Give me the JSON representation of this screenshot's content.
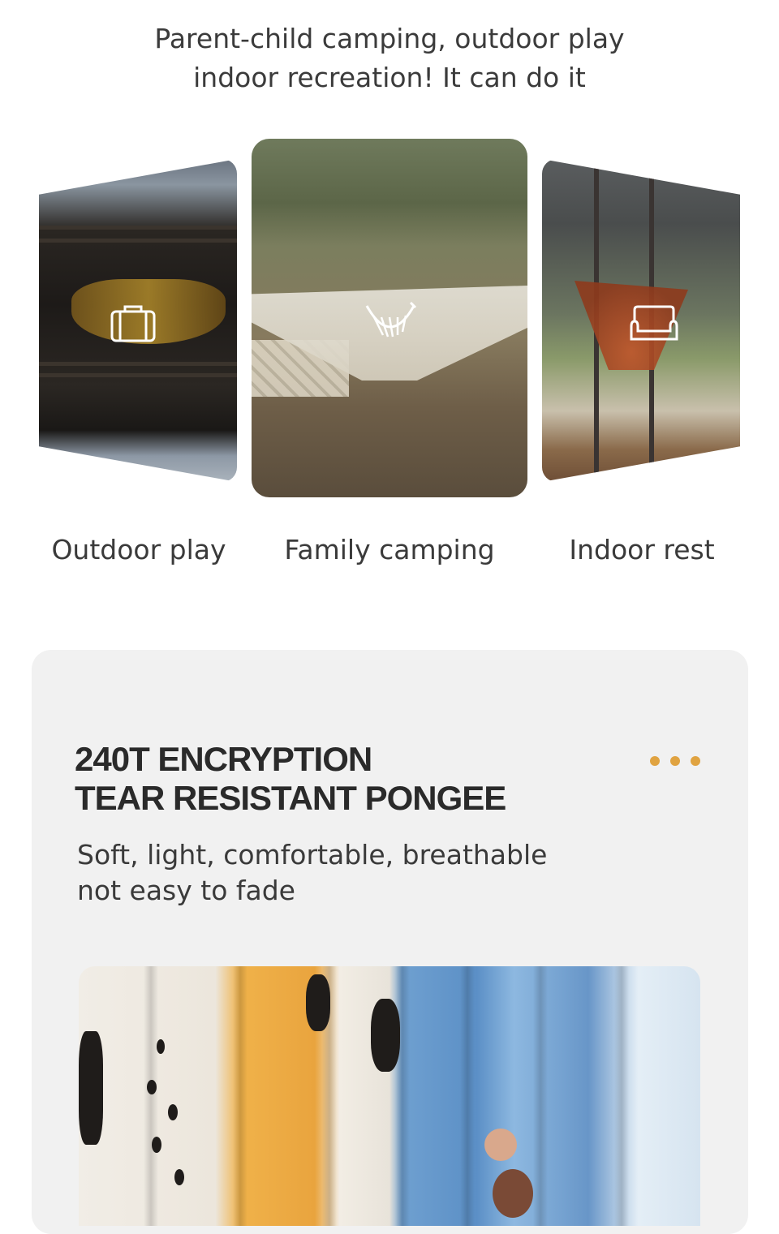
{
  "intro": {
    "line1": "Parent-child camping, outdoor play",
    "line2": "indoor recreation! It can do it"
  },
  "scenes": [
    {
      "label": "Outdoor play",
      "icon": "suitcase-icon"
    },
    {
      "label": "Family camping",
      "icon": "hammock-icon"
    },
    {
      "label": "Indoor rest",
      "icon": "sofa-icon"
    }
  ],
  "feature": {
    "title_line1": "240T ENCRYPTION",
    "title_line2": "TEAR RESISTANT PONGEE",
    "desc_line1": "Soft, light, comfortable, breathable",
    "desc_line2": "not easy to fade"
  },
  "colors": {
    "accent": "#e0a341",
    "panel": "#f1f1f1",
    "text": "#3a3a3a"
  }
}
